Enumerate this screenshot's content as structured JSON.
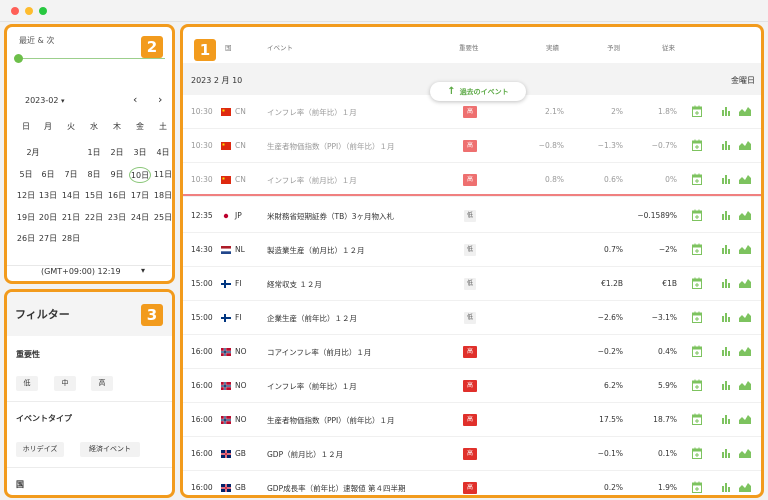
{
  "window": {
    "dots": [
      "#ff5f57",
      "#febc2e",
      "#28c840"
    ]
  },
  "badges": {
    "main": "1",
    "calendar": "2",
    "filter": "3"
  },
  "calendar": {
    "range_label": "最近 & 次",
    "month": "2023-02",
    "month_caret": "▾",
    "prev": "‹",
    "next": "›",
    "weekdays": [
      "日",
      "月",
      "火",
      "水",
      "木",
      "金",
      "土"
    ],
    "month_short": "2月",
    "days": [
      {
        "label": "1日",
        "col": 3,
        "week": 0
      },
      {
        "label": "2日",
        "col": 4,
        "week": 0
      },
      {
        "label": "3日",
        "col": 5,
        "week": 0
      },
      {
        "label": "4日",
        "col": 6,
        "week": 0
      },
      {
        "label": "5日",
        "col": 0,
        "week": 1
      },
      {
        "label": "6日",
        "col": 1,
        "week": 1
      },
      {
        "label": "7日",
        "col": 2,
        "week": 1
      },
      {
        "label": "8日",
        "col": 3,
        "week": 1
      },
      {
        "label": "9日",
        "col": 4,
        "week": 1
      },
      {
        "label": "10日",
        "col": 5,
        "week": 1,
        "selected": true
      },
      {
        "label": "11日",
        "col": 6,
        "week": 1
      },
      {
        "label": "12日",
        "col": 0,
        "week": 2
      },
      {
        "label": "13日",
        "col": 1,
        "week": 2
      },
      {
        "label": "14日",
        "col": 2,
        "week": 2
      },
      {
        "label": "15日",
        "col": 3,
        "week": 2
      },
      {
        "label": "16日",
        "col": 4,
        "week": 2
      },
      {
        "label": "17日",
        "col": 5,
        "week": 2
      },
      {
        "label": "18日",
        "col": 6,
        "week": 2
      },
      {
        "label": "19日",
        "col": 0,
        "week": 3
      },
      {
        "label": "20日",
        "col": 1,
        "week": 3
      },
      {
        "label": "21日",
        "col": 2,
        "week": 3
      },
      {
        "label": "22日",
        "col": 3,
        "week": 3
      },
      {
        "label": "23日",
        "col": 4,
        "week": 3
      },
      {
        "label": "24日",
        "col": 5,
        "week": 3
      },
      {
        "label": "25日",
        "col": 6,
        "week": 3
      },
      {
        "label": "26日",
        "col": 0,
        "week": 4
      },
      {
        "label": "27日",
        "col": 1,
        "week": 4
      },
      {
        "label": "28日",
        "col": 2,
        "week": 4
      }
    ],
    "timezone": "(GMT+09:00) 12:19",
    "timezone_caret": "▾"
  },
  "filter": {
    "title": "フィルター",
    "importance_label": "重要性",
    "importance_options": [
      "低",
      "中",
      "高"
    ],
    "event_type_label": "イベントタイプ",
    "event_types": [
      "ホリデイズ",
      "経済イベント"
    ],
    "country_label": "国"
  },
  "table": {
    "headers": {
      "country": "国",
      "event": "イベント",
      "importance": "重要性",
      "actual": "実績",
      "forecast": "予測",
      "previous": "従来"
    },
    "date": "2023 2 月 10",
    "weekday": "金曜日",
    "past_button": "過去のイベント",
    "colors": {
      "accent": "#f29b1d",
      "high": "#e0302b",
      "green": "#6dbf4a"
    },
    "rows": [
      {
        "time": "10:30",
        "flag": "cn",
        "country": "CN",
        "event": "インフレ率（前年比）１月",
        "importance": "高",
        "level": "high",
        "actual": "2.1%",
        "forecast": "2%",
        "previous": "1.8%",
        "past": true
      },
      {
        "time": "10:30",
        "flag": "cn",
        "country": "CN",
        "event": "生産者物価指数（PPI）（前年比）１月",
        "importance": "高",
        "level": "high",
        "actual": "−0.8%",
        "forecast": "−1.3%",
        "previous": "−0.7%",
        "past": true
      },
      {
        "time": "10:30",
        "flag": "cn",
        "country": "CN",
        "event": "インフレ率（前月比）１月",
        "importance": "高",
        "level": "high",
        "actual": "0.8%",
        "forecast": "0.6%",
        "previous": "0%",
        "past": true
      },
      {
        "time": "12:35",
        "flag": "jp",
        "country": "JP",
        "event": "米財務省短期証券（TB）3ヶ月物入札",
        "importance": "低",
        "level": "low",
        "actual": "",
        "forecast": "",
        "previous": "−0.1589%",
        "past": false
      },
      {
        "time": "14:30",
        "flag": "nl",
        "country": "NL",
        "event": "製造業生産（前月比）１２月",
        "importance": "低",
        "level": "low",
        "actual": "",
        "forecast": "0.7%",
        "previous": "−2%",
        "past": false
      },
      {
        "time": "15:00",
        "flag": "fi",
        "country": "FI",
        "event": "経常収支 １２月",
        "importance": "低",
        "level": "low",
        "actual": "",
        "forecast": "€1.2B",
        "previous": "€1B",
        "past": false
      },
      {
        "time": "15:00",
        "flag": "fi",
        "country": "FI",
        "event": "企業生産（前年比）１２月",
        "importance": "低",
        "level": "low",
        "actual": "",
        "forecast": "−2.6%",
        "previous": "−3.1%",
        "past": false
      },
      {
        "time": "16:00",
        "flag": "no",
        "country": "NO",
        "event": "コアインフレ率（前月比）１月",
        "importance": "高",
        "level": "high",
        "actual": "",
        "forecast": "−0.2%",
        "previous": "0.4%",
        "past": false
      },
      {
        "time": "16:00",
        "flag": "no",
        "country": "NO",
        "event": "インフレ率（前年比）１月",
        "importance": "高",
        "level": "high",
        "actual": "",
        "forecast": "6.2%",
        "previous": "5.9%",
        "past": false
      },
      {
        "time": "16:00",
        "flag": "no",
        "country": "NO",
        "event": "生産者物価指数（PPI）（前年比）１月",
        "importance": "高",
        "level": "high",
        "actual": "",
        "forecast": "17.5%",
        "previous": "18.7%",
        "past": false
      },
      {
        "time": "16:00",
        "flag": "gb",
        "country": "GB",
        "event": "GDP（前月比）１２月",
        "importance": "高",
        "level": "high",
        "actual": "",
        "forecast": "−0.1%",
        "previous": "0.1%",
        "past": false
      },
      {
        "time": "16:00",
        "flag": "gb",
        "country": "GB",
        "event": "GDP成長率（前年比）速報値 第４四半期",
        "importance": "高",
        "level": "high",
        "actual": "",
        "forecast": "0.2%",
        "previous": "1.9%",
        "past": false
      }
    ]
  }
}
